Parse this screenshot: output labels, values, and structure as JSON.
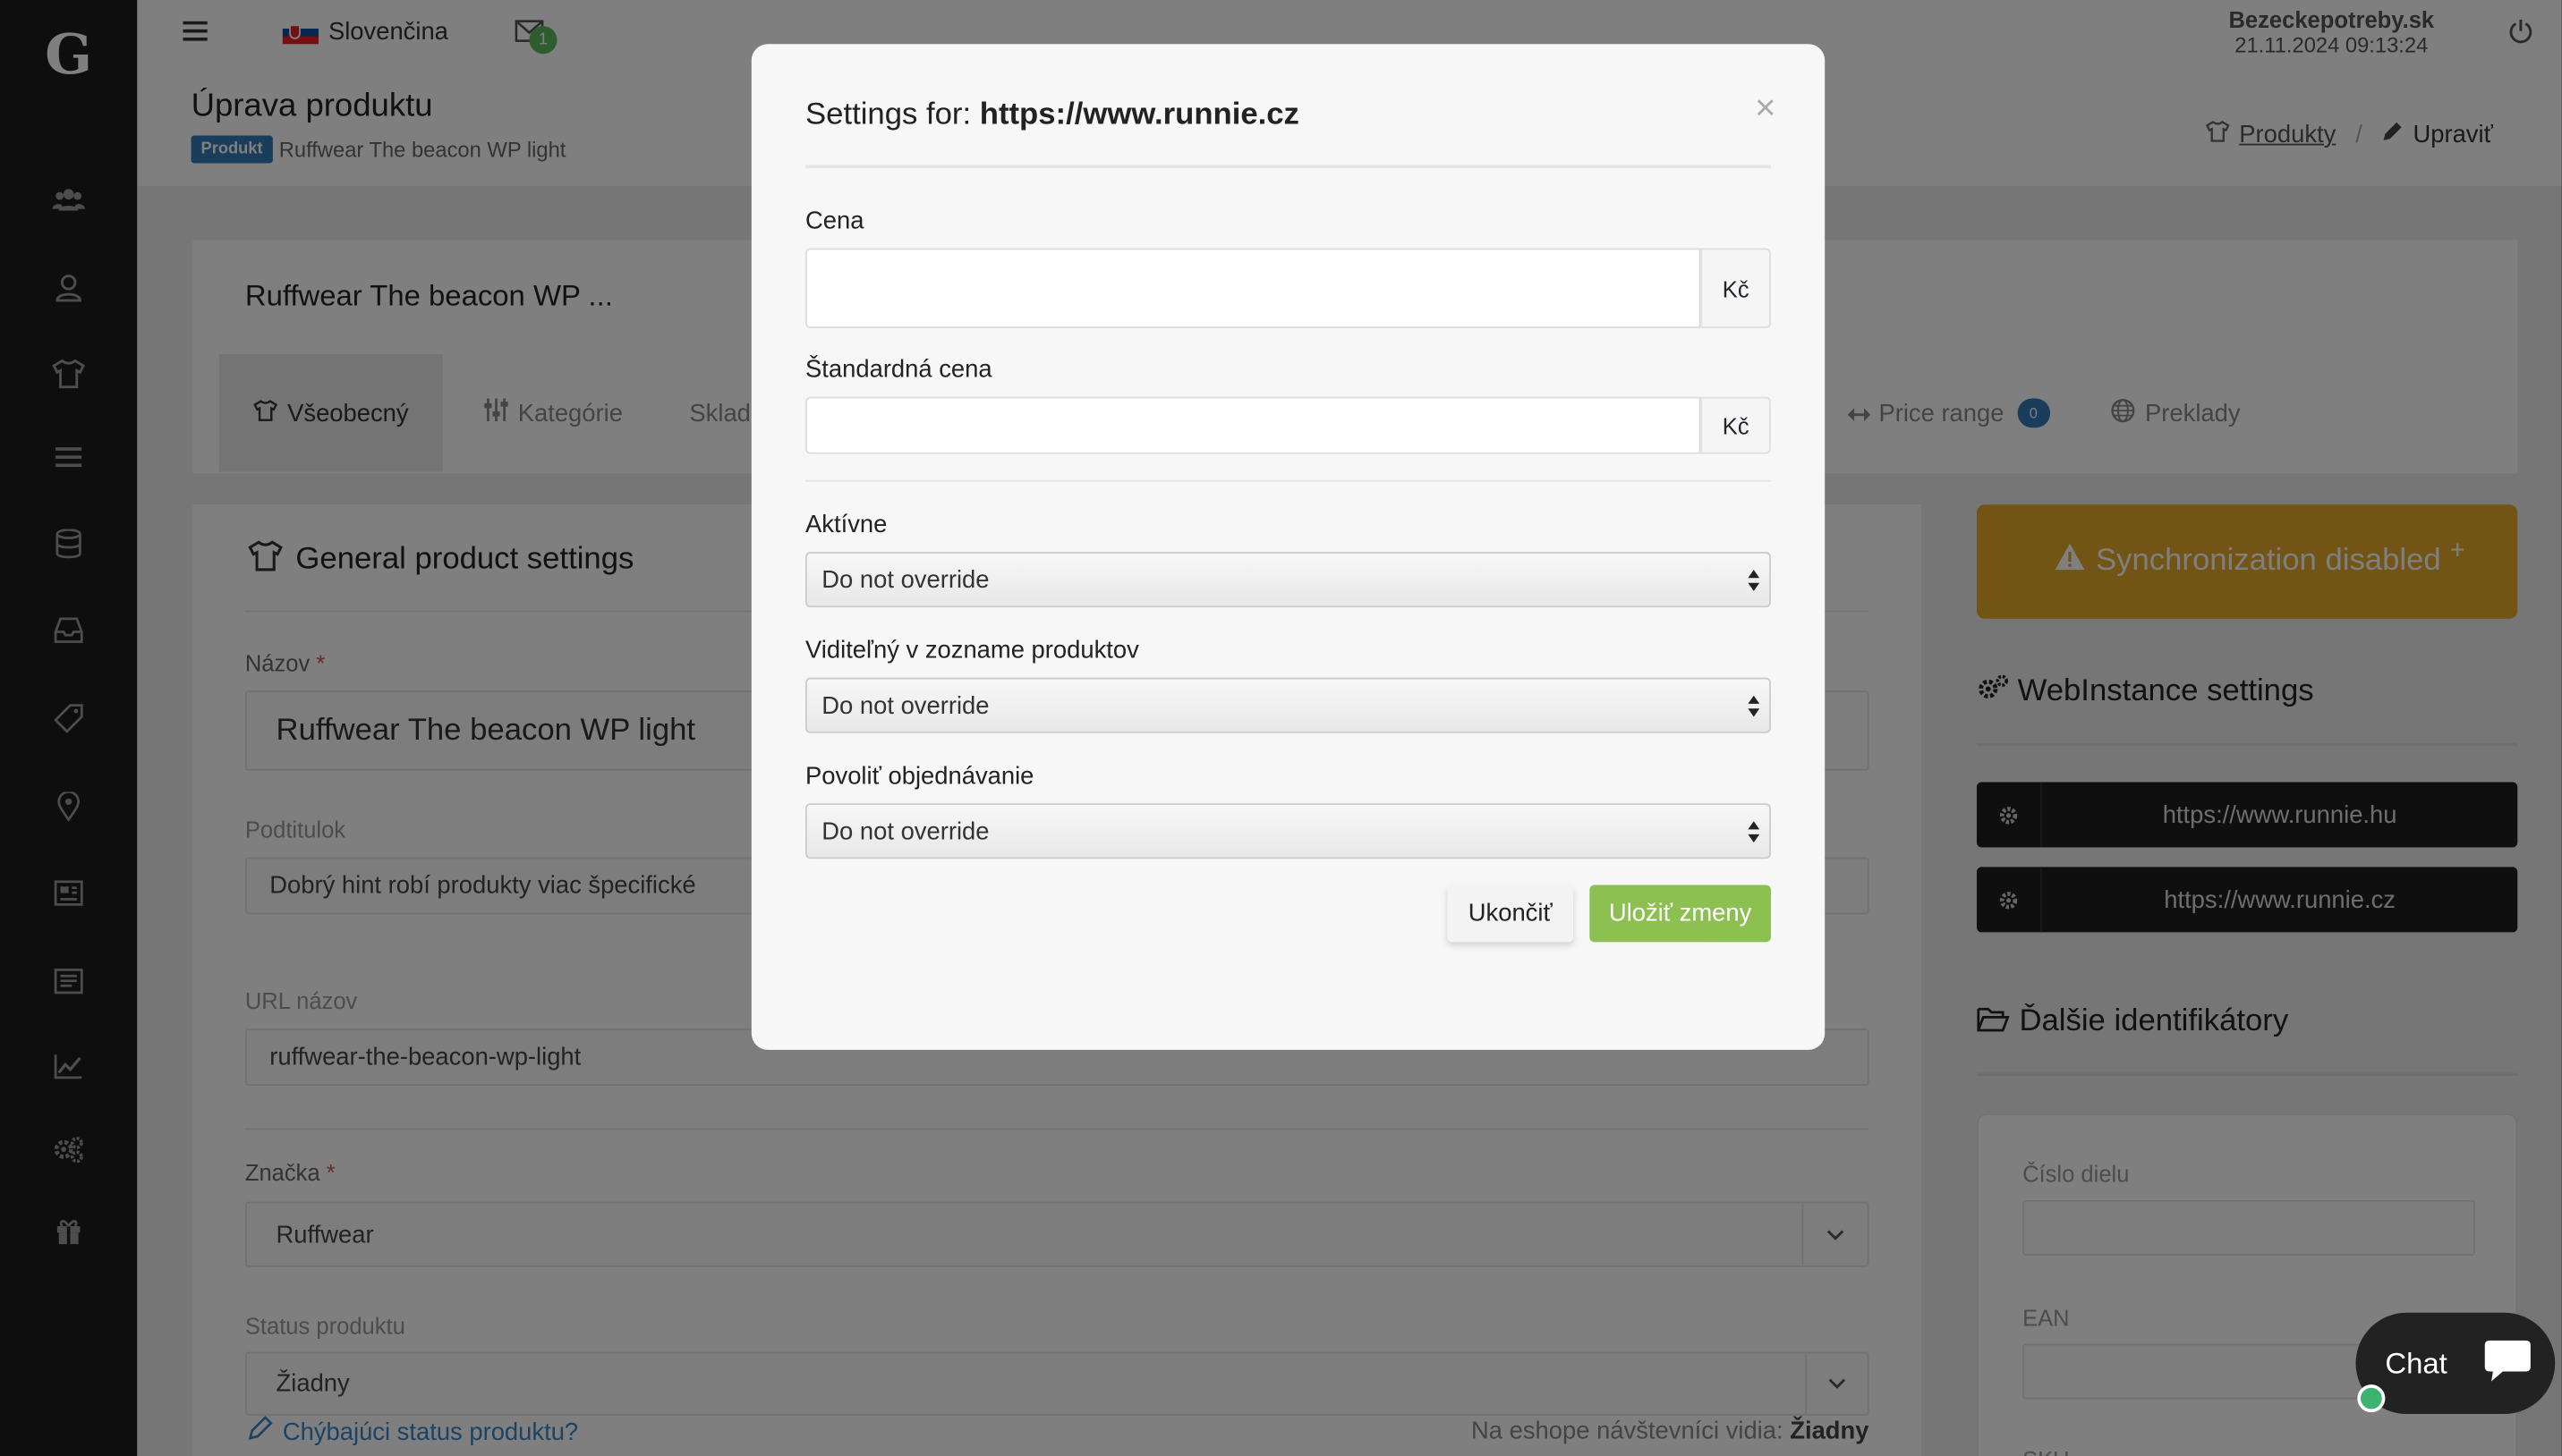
{
  "sidebar": {
    "logo": "G",
    "icons": [
      "users-icon",
      "user-icon",
      "tshirt-icon",
      "list-icon",
      "database-icon",
      "inbox-icon",
      "tag-icon",
      "map-marker-icon",
      "newspaper-icon",
      "document-icon",
      "chart-icon",
      "gears-icon",
      "gift-icon"
    ]
  },
  "topbar": {
    "language": "Slovenčina",
    "notification_count": "1",
    "shop_name": "Bezeckepotreby.sk",
    "datetime": "21.11.2024 09:13:24"
  },
  "pagehead": {
    "title": "Úprava produktu",
    "badge": "Produkt",
    "subtitle": "Ruffwear The beacon WP light",
    "breadcrumb_products": "Produkty",
    "breadcrumb_sep": "/",
    "breadcrumb_edit": "Upraviť"
  },
  "product_card": {
    "title": "Ruffwear The beacon WP ...",
    "tabs": {
      "general": "Všeobecný",
      "categories": "Kategórie",
      "stock": "Sklad",
      "price_range": "Price range",
      "price_range_count": "0",
      "translations": "Preklady"
    }
  },
  "general": {
    "heading": "General product settings",
    "name_label": "Názov",
    "name_value": "Ruffwear The beacon WP light",
    "subtitle_label": "Podtitulok",
    "subtitle_value": "Dobrý hint robí produkty viac špecifické",
    "url_label": "URL názov",
    "url_value": "ruffwear-the-beacon-wp-light",
    "brand_label": "Značka",
    "brand_value": "Ruffwear",
    "status_label": "Status produktu",
    "status_value": "Žiadny",
    "missing_status_link": "Chýbajúci status produktu?",
    "visitors_see_prefix": "Na eshope návštevníci vidia:",
    "visitors_see_value": "Žiadny",
    "required_mark": "*"
  },
  "right_panel": {
    "sync_button": "Synchronization disabled",
    "webinstance_heading": "WebInstance settings",
    "webinstances": [
      "https://www.runnie.hu",
      "https://www.runnie.cz"
    ],
    "identifiers_heading": "Ďalšie identifikátory",
    "part_number_label": "Číslo dielu",
    "ean_label": "EAN",
    "sku_label": "SKU"
  },
  "modal": {
    "title_prefix": "Settings for:",
    "title_url": "https://www.runnie.cz",
    "close": "×",
    "price_label": "Cena",
    "price_value": "",
    "currency": "Kč",
    "standard_price_label": "Štandardná cena",
    "standard_price_value": "",
    "active_label": "Aktívne",
    "active_value": "Do not override",
    "visible_label": "Viditeľný v zozname produktov",
    "visible_value": "Do not override",
    "ordering_label": "Povoliť objednávanie",
    "ordering_value": "Do not override",
    "cancel_button": "Ukončiť",
    "save_button": "Uložiť zmeny"
  },
  "chat": {
    "label": "Chat"
  },
  "colors": {
    "sidebar_bg": "#1d1d1f",
    "sync_bg": "#e5a92a",
    "save_bg": "#8cc152",
    "link": "#3a87c8",
    "required": "#d9534f",
    "badge": "#337ab7"
  }
}
